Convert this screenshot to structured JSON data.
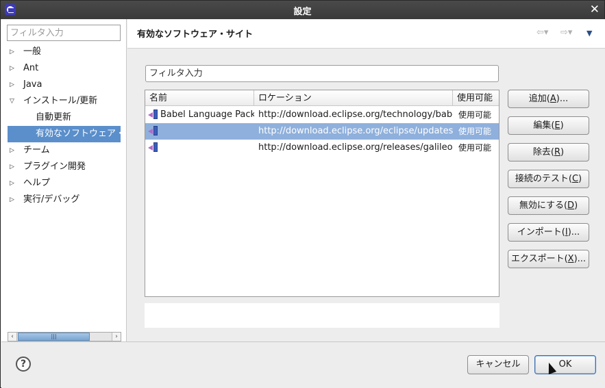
{
  "window": {
    "title": "設定",
    "close_glyph": "✕",
    "app_icon": "eclipse-icon"
  },
  "sidebar": {
    "filter_placeholder": "フィルタ入力",
    "items": [
      {
        "label": "一般",
        "level": 0,
        "twisty": "▷"
      },
      {
        "label": "Ant",
        "level": 0,
        "twisty": "▷"
      },
      {
        "label": "Java",
        "level": 0,
        "twisty": "▷"
      },
      {
        "label": "インストール/更新",
        "level": 0,
        "twisty": "▽"
      },
      {
        "label": "自動更新",
        "level": 1
      },
      {
        "label": "有効なソフトウェア・",
        "level": 1,
        "selected": true
      },
      {
        "label": "チーム",
        "level": 0,
        "twisty": "▷"
      },
      {
        "label": "プラグイン開発",
        "level": 0,
        "twisty": "▷"
      },
      {
        "label": "ヘルプ",
        "level": 0,
        "twisty": "▷"
      },
      {
        "label": "実行/デバッグ",
        "level": 0,
        "twisty": "▷"
      }
    ],
    "scroll": {
      "left_glyph": "‹",
      "right_glyph": "›",
      "thumb_grip": "|||"
    }
  },
  "page": {
    "title": "有効なソフトウェア・サイト",
    "nav_back_glyph": "⇦▾",
    "nav_forward_glyph": "⇨▾",
    "menu_glyph": "▼",
    "filter_placeholder": "フィルタ入力"
  },
  "table": {
    "columns": [
      "名前",
      "ロケーション",
      "使用可能"
    ],
    "rows": [
      {
        "name": "Babel Language Pack",
        "location": "http://download.eclipse.org/technology/babel",
        "enabled": "使用可能"
      },
      {
        "name": "",
        "location": "http://download.eclipse.org/eclipse/updates",
        "enabled": "使用可能",
        "selected": true
      },
      {
        "name": "",
        "location": "http://download.eclipse.org/releases/galileo",
        "enabled": "使用可能"
      }
    ]
  },
  "buttons": {
    "add": {
      "pre": "追加(",
      "mn": "A",
      "post": ")..."
    },
    "edit": {
      "pre": "編集(",
      "mn": "E",
      "post": ")"
    },
    "remove": {
      "pre": "除去(",
      "mn": "R",
      "post": ")"
    },
    "test": {
      "pre": "接続のテスト(",
      "mn": "C",
      "post": ")"
    },
    "disable": {
      "pre": "無効にする(",
      "mn": "D",
      "post": ")"
    },
    "import": {
      "pre": "インポート(",
      "mn": "I",
      "post": ")..."
    },
    "export": {
      "pre": "エクスポート(",
      "mn": "X",
      "post": ")..."
    }
  },
  "footer": {
    "help_glyph": "?",
    "cancel_label": "キャンセル",
    "ok_label": "OK"
  }
}
